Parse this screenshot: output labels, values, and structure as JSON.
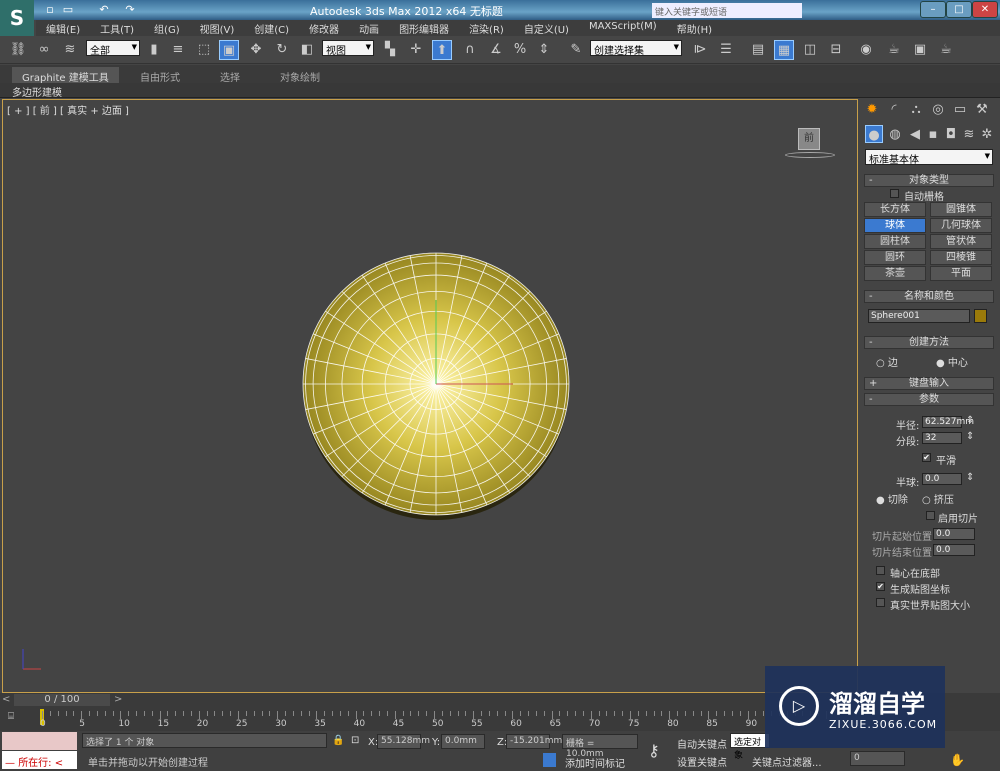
{
  "app": {
    "title": "Autodesk 3ds Max  2012 x64    无标题",
    "search_placeholder": "键入关键字或短语",
    "logo": "S"
  },
  "menu": [
    "编辑(E)",
    "工具(T)",
    "组(G)",
    "视图(V)",
    "创建(C)",
    "修改器",
    "动画",
    "图形编辑器",
    "渲染(R)",
    "自定义(U)",
    "MAXScript(M)",
    "帮助(H)"
  ],
  "toolbar": {
    "filter": "全部",
    "coord": "视图",
    "selection_set": "创建选择集"
  },
  "ribbon": {
    "tabs": [
      "Graphite 建模工具",
      "自由形式",
      "选择",
      "对象绘制"
    ],
    "sub": "多边形建模"
  },
  "viewport": {
    "label": "[ + ] [ 前 ] [ 真实 + 边面 ]",
    "viewcube": "前",
    "object_color": "#c8b43c",
    "segments": 32
  },
  "panel": {
    "category": "标准基本体",
    "object_type": {
      "title": "对象类型",
      "autogrid": "自动栅格",
      "buttons": [
        "长方体",
        "圆锥体",
        "球体",
        "几何球体",
        "圆柱体",
        "管状体",
        "圆环",
        "四棱锥",
        "茶壶",
        "平面"
      ],
      "active": "球体"
    },
    "name_color": {
      "title": "名称和颜色",
      "name": "Sphere001",
      "color": "#9a7a0a"
    },
    "creation": {
      "title": "创建方法",
      "edge": "边",
      "center": "中心"
    },
    "keyboard": "键盘输入",
    "params": {
      "title": "参数",
      "radius_label": "半径:",
      "radius": "62.527mm",
      "segments_label": "分段:",
      "segments": "32",
      "smooth": "平滑",
      "hemisphere_label": "半球:",
      "hemisphere": "0.0",
      "chop": "切除",
      "squash": "挤压",
      "slice_on": "启用切片",
      "slice_from_label": "切片起始位置:",
      "slice_from": "0.0",
      "slice_to_label": "切片结束位置:",
      "slice_to": "0.0",
      "base_pivot": "轴心在底部",
      "gen_mapping": "生成贴图坐标",
      "real_world": "真实世界贴图大小"
    }
  },
  "timeline": {
    "frame": "0 / 100",
    "ticks": [
      "0",
      "5",
      "10",
      "15",
      "20",
      "25",
      "30",
      "35",
      "40",
      "45",
      "50",
      "55",
      "60",
      "65",
      "70",
      "75",
      "80",
      "85",
      "90"
    ]
  },
  "status": {
    "running": "所在行:",
    "selected": "选择了 1 个 对象",
    "prompt": "单击并拖动以开始创建过程",
    "x": "55.128mm",
    "y": "0.0mm",
    "z": "-15.201mm",
    "x_label": "X:",
    "y_label": "Y:",
    "z_label": "Z:",
    "grid": "栅格 = 10.0mm",
    "add_tag": "添加时间标记",
    "autokey": "自动关键点",
    "setkey": "设置关键点",
    "selected_obj": "选定对象",
    "key_filter": "关键点过滤器...",
    "frame_val": "0"
  },
  "watermark": {
    "name": "溜溜自学",
    "url": "ZIXUE.3066.COM"
  }
}
